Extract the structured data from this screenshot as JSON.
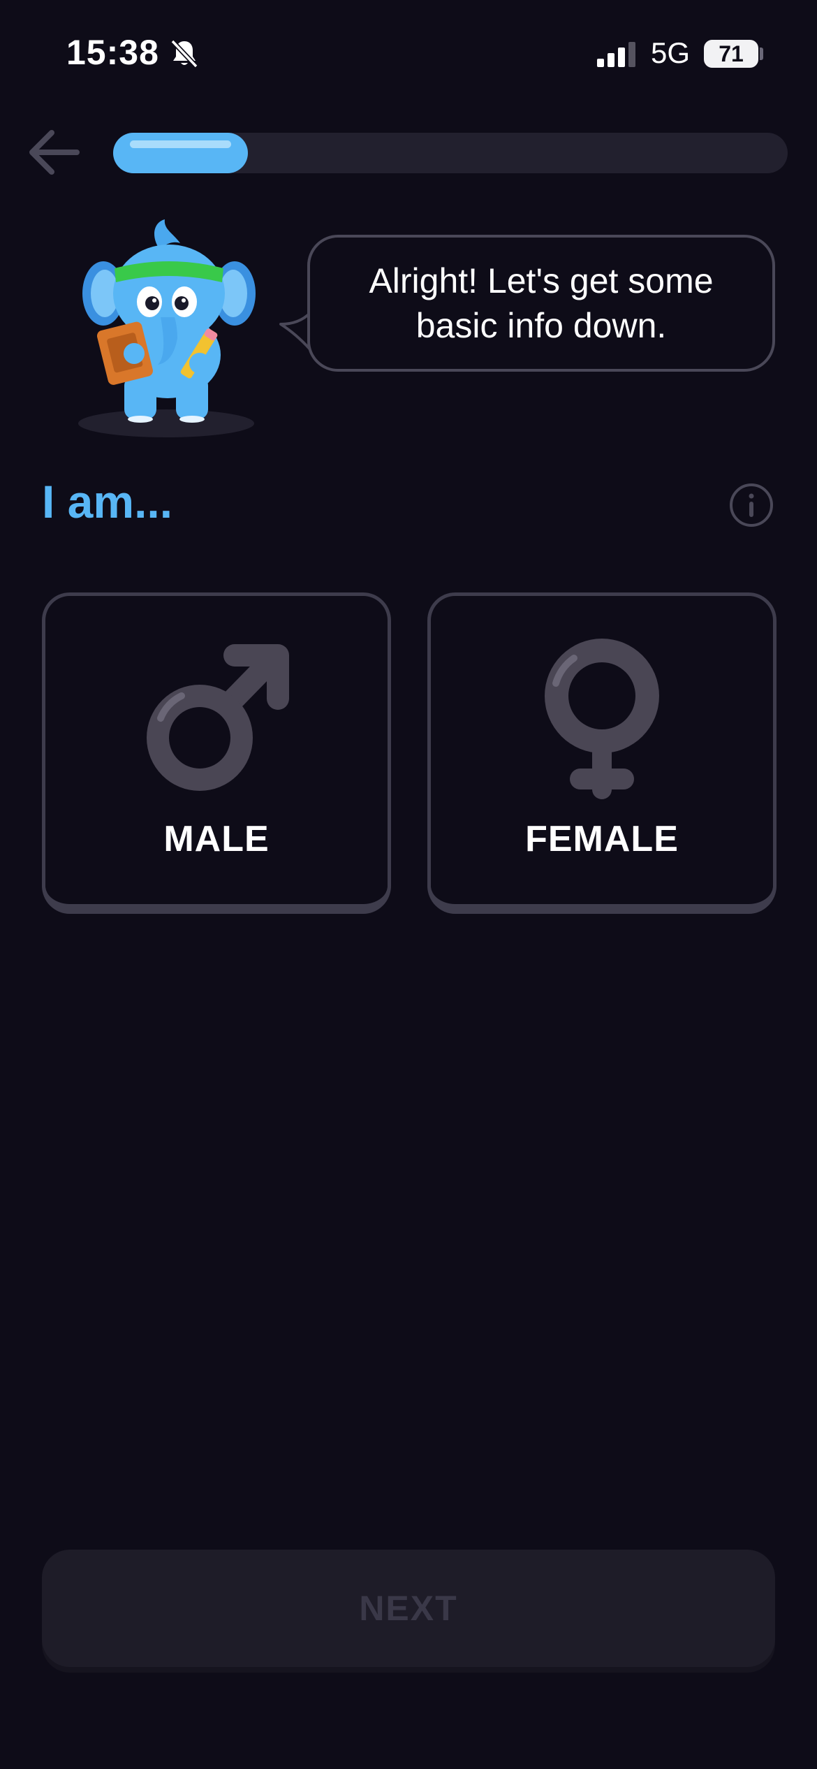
{
  "status_bar": {
    "time": "15:38",
    "network": "5G",
    "battery_level": "71",
    "icons": [
      "bell-muted-icon",
      "signal-icon",
      "battery-icon"
    ]
  },
  "header": {
    "back_icon": "arrow-left-icon",
    "progress_fraction": 0.2
  },
  "mascot": {
    "icon": "elephant-mascot"
  },
  "speech_bubble": {
    "text": "Alright! Let's get some basic info down."
  },
  "question": {
    "title": "I am...",
    "info_icon": "info-icon"
  },
  "options": [
    {
      "label": "MALE",
      "icon": "male-symbol-icon"
    },
    {
      "label": "FEMALE",
      "icon": "female-symbol-icon"
    }
  ],
  "footer": {
    "next_label": "NEXT"
  },
  "colors": {
    "background": "#0e0c18",
    "accent": "#58b6f5",
    "card_border": "#3e3c4c",
    "disabled_button": "#1e1c28",
    "disabled_text": "#3a3848"
  }
}
